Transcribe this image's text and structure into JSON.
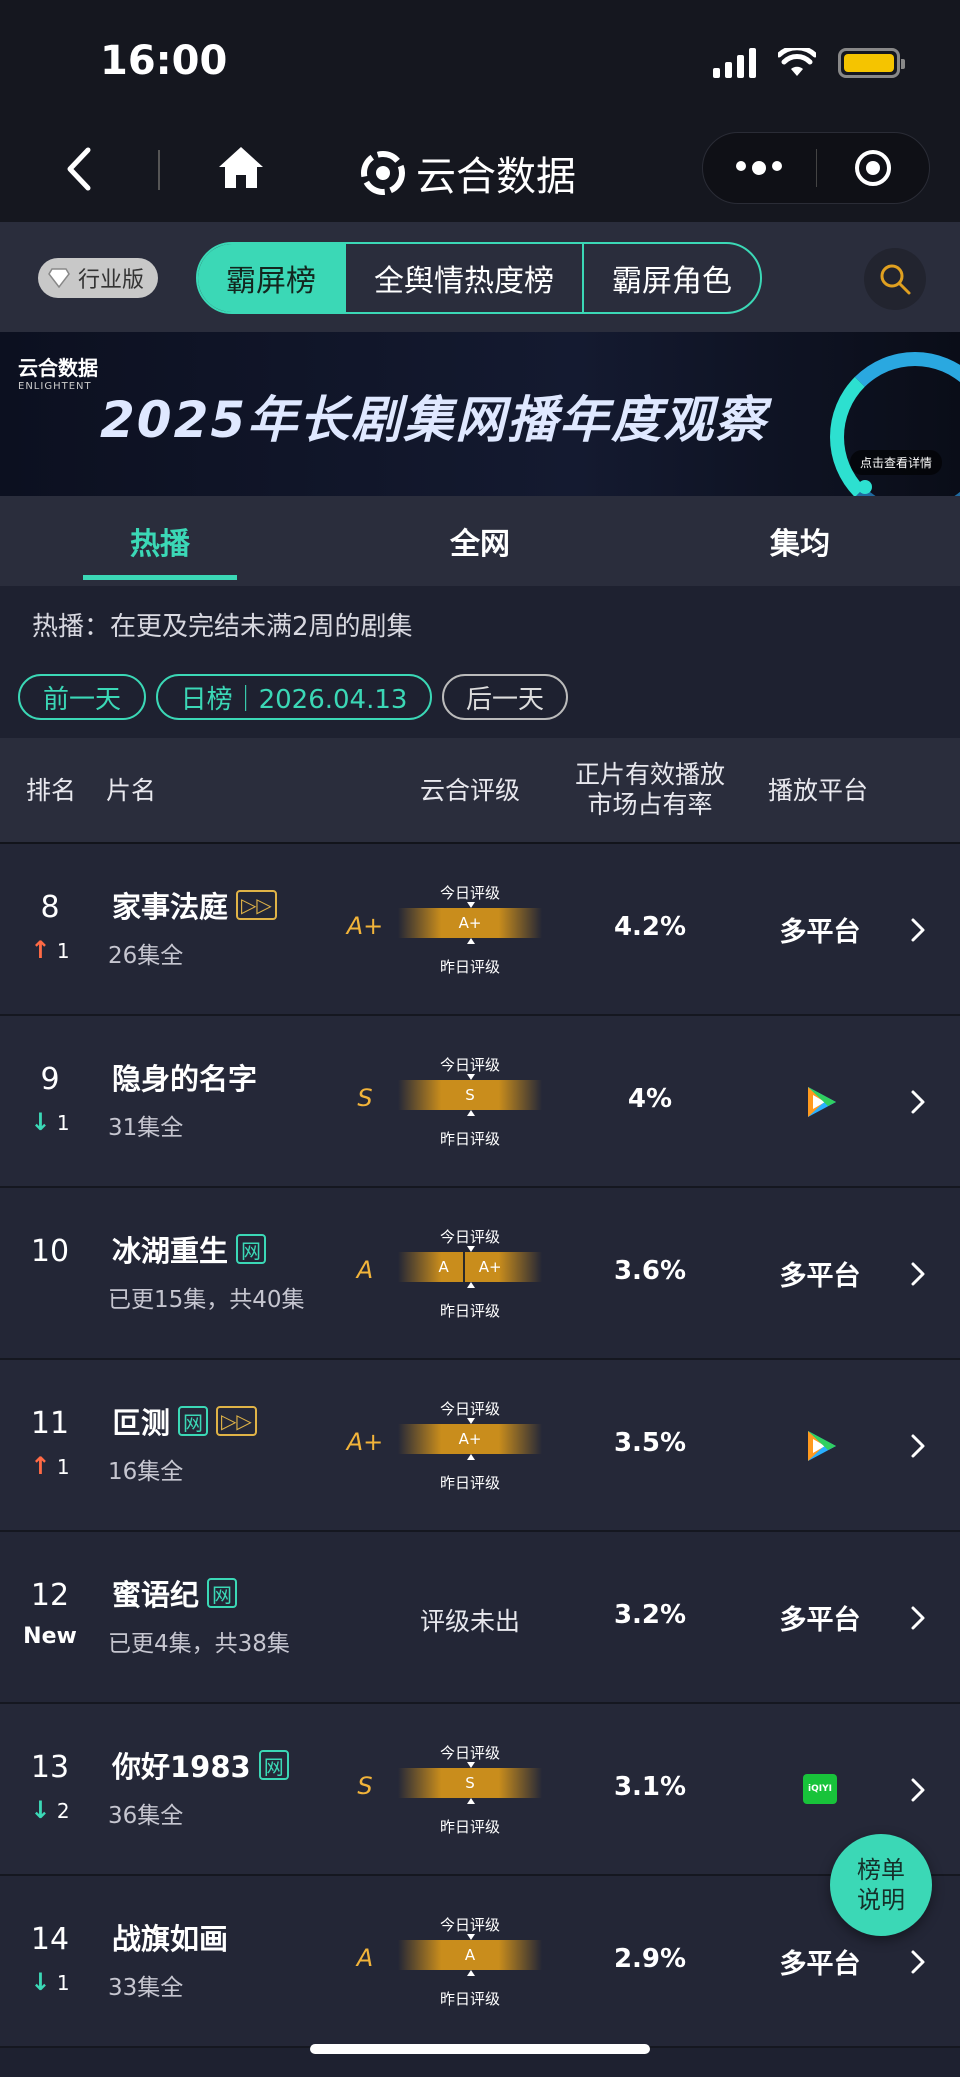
{
  "status_bar": {
    "time": "16:00"
  },
  "nav": {
    "app_title": "云合数据"
  },
  "top_tabs": {
    "badge": "行业版",
    "items": [
      "霸屏榜",
      "全舆情热度榜",
      "霸屏角色"
    ],
    "active": 0
  },
  "banner": {
    "logo_cn": "云合数据",
    "logo_en": "ENLIGHTENT",
    "title": "2025年长剧集网播年度观察",
    "cta": "点击查看详情"
  },
  "sub_tabs": {
    "items": [
      "热播",
      "全网",
      "集均"
    ],
    "active": 0
  },
  "info": {
    "description": "热播：在更及完结未满2周的剧集",
    "prev_label": "前一天",
    "date_label": "日榜｜2026.04.13",
    "next_label": "后一天"
  },
  "table_header": {
    "rank": "排名",
    "title": "片名",
    "grade": "云合评级",
    "share_line1": "正片有效播放",
    "share_line2": "市场占有率",
    "platform": "播放平台"
  },
  "rating_labels": {
    "today": "今日评级",
    "yesterday": "昨日评级",
    "none": "评级未出"
  },
  "rows": [
    {
      "rank": "8",
      "change_dir": "up",
      "change": "1",
      "title": "家事法庭",
      "tags": [
        "ff"
      ],
      "episodes": "26集全",
      "grade": "A+",
      "bar": [
        "A+"
      ],
      "share": "4.2%",
      "platform": "多平台",
      "platform_icon": ""
    },
    {
      "rank": "9",
      "change_dir": "down",
      "change": "1",
      "title": "隐身的名字",
      "tags": [],
      "episodes": "31集全",
      "grade": "S",
      "bar": [
        "S"
      ],
      "share": "4%",
      "platform": "",
      "platform_icon": "tencent-video-icon"
    },
    {
      "rank": "10",
      "change_dir": "",
      "change": "",
      "title": "冰湖重生",
      "tags": [
        "net"
      ],
      "episodes": "已更15集，共40集",
      "grade": "A",
      "bar": [
        "A",
        "A+"
      ],
      "share": "3.6%",
      "platform": "多平台",
      "platform_icon": ""
    },
    {
      "rank": "11",
      "change_dir": "up",
      "change": "1",
      "title": "叵测",
      "tags": [
        "net",
        "ff"
      ],
      "episodes": "16集全",
      "grade": "A+",
      "bar": [
        "A+"
      ],
      "share": "3.5%",
      "platform": "",
      "platform_icon": "tencent-video-icon"
    },
    {
      "rank": "12",
      "change_dir": "new",
      "change": "New",
      "title": "蜜语纪",
      "tags": [
        "net"
      ],
      "episodes": "已更4集，共38集",
      "grade": "",
      "bar": [],
      "share": "3.2%",
      "platform": "多平台",
      "platform_icon": ""
    },
    {
      "rank": "13",
      "change_dir": "down",
      "change": "2",
      "title": "你好1983",
      "tags": [
        "net"
      ],
      "episodes": "36集全",
      "grade": "S",
      "bar": [
        "S"
      ],
      "share": "3.1%",
      "platform": "",
      "platform_icon": "iqiyi-icon"
    },
    {
      "rank": "14",
      "change_dir": "down",
      "change": "1",
      "title": "战旗如画",
      "tags": [],
      "episodes": "33集全",
      "grade": "A",
      "bar": [
        "A"
      ],
      "share": "2.9%",
      "platform": "多平台",
      "platform_icon": ""
    }
  ],
  "tag_labels": {
    "net": "网",
    "ff": "▷▷",
    "iqiyi": "iQIYI"
  },
  "float_button": {
    "line1": "榜单",
    "line2": "说明"
  },
  "colors": {
    "accent": "#3bd8b6",
    "grade": "#f2b43a",
    "up": "#ff6a45",
    "down": "#3bd8b6"
  }
}
